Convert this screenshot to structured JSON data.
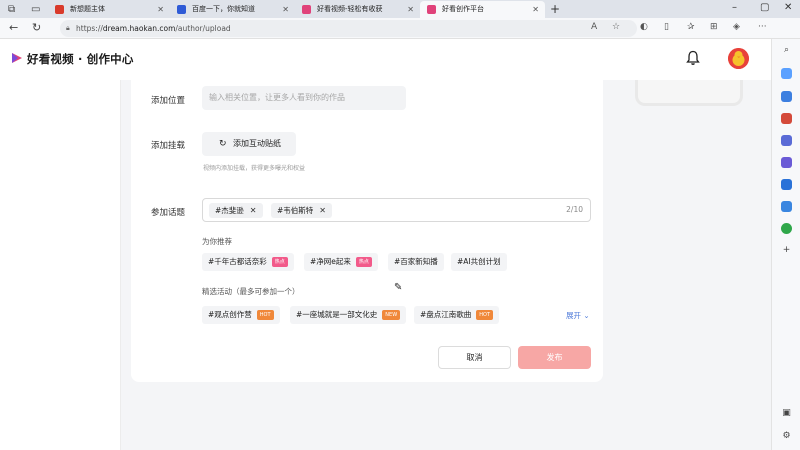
{
  "browser": {
    "tabs": [
      {
        "title": "新想题主体",
        "color": "#d93a2b",
        "active": false
      },
      {
        "title": "百度一下，你就知道",
        "color": "#2f5bd6",
        "active": false
      },
      {
        "title": "好看视频-轻松有收获",
        "color": "#e0427a",
        "active": false
      },
      {
        "title": "好看创作平台",
        "color": "#e0427a",
        "active": true
      }
    ],
    "url_prefix": "https://",
    "url_domain": "dream.haokan.com",
    "url_path": "/author/upload"
  },
  "header": {
    "logo_text": "好看视频 · 创作中心"
  },
  "form": {
    "location": {
      "label": "添加位置",
      "placeholder": "输入相关位置，让更多人看到你的作品"
    },
    "mount": {
      "label": "添加挂载",
      "button_label": "添加互动贴纸",
      "hint": "视频内添加挂载，获得更多曝光和权益"
    },
    "topics": {
      "label": "参加话题",
      "selected": [
        "#杰斐逊",
        "#韦伯斯特"
      ],
      "count": "2/10",
      "recommend_title": "为你推荐",
      "recommended": [
        {
          "text": "#千年古都话奈彩",
          "badge": "热点",
          "badge_type": "red"
        },
        {
          "text": "#净网e起来",
          "badge": "热点",
          "badge_type": "red"
        },
        {
          "text": "#百家新知播",
          "badge": "",
          "badge_type": ""
        },
        {
          "text": "#AI共创计划",
          "badge": "",
          "badge_type": ""
        }
      ],
      "activities_title": "精选活动（最多可参加一个）",
      "activities": [
        {
          "text": "#观点创作营",
          "badge": "HOT",
          "badge_type": "hot"
        },
        {
          "text": "#一座城就是一部文化史",
          "badge": "NEW",
          "badge_type": "new"
        },
        {
          "text": "#盘点江南歌曲",
          "badge": "HOT",
          "badge_type": "hot"
        }
      ],
      "expand_label": "展开"
    },
    "actions": {
      "cancel_label": "取消",
      "publish_label": "发布"
    }
  },
  "colors": {
    "publish_disabled": "#f7a7a5",
    "expand_link": "#4f7bd9",
    "brand": "#e0427a"
  }
}
